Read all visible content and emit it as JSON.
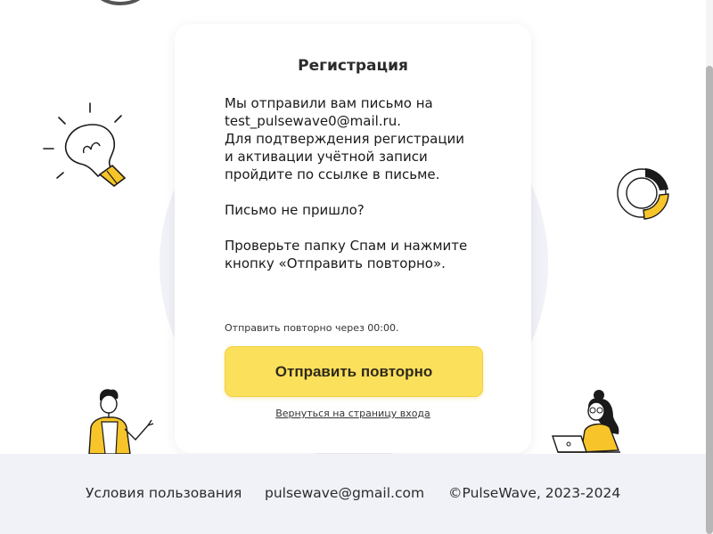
{
  "card": {
    "title": "Регистрация",
    "message_lines": [
      "Мы отправили вам письмо на",
      "test_pulsewave0@mail.ru.",
      "Для подтверждения регистрации",
      "и активации учётной записи",
      "пройдите по ссылке в письме."
    ],
    "not_received": "Письмо не пришло?",
    "instruction_lines": [
      "Проверьте папку Спам и нажмите",
      "кнопку «Отправить повторно»."
    ],
    "timer_text": "Отправить повторно через 00:00.",
    "resend_button": "Отправить повторно",
    "back_link": "Вернуться на страницу входа"
  },
  "footer": {
    "terms": "Условия пользования",
    "email": "pulsewave@gmail.com",
    "copyright": "©PulseWave, 2023-2024"
  },
  "icons": {
    "lightbulb": "lightbulb-icon",
    "progress_ring": "progress-ring-icon",
    "person_pointing": "person-pointing-illustration",
    "person_laptop": "person-laptop-illustration"
  },
  "colors": {
    "accent": "#fbe05b",
    "background_shape": "#f1f2f8",
    "footer_bg": "#f1f2f8",
    "text": "#1a1a1a"
  }
}
